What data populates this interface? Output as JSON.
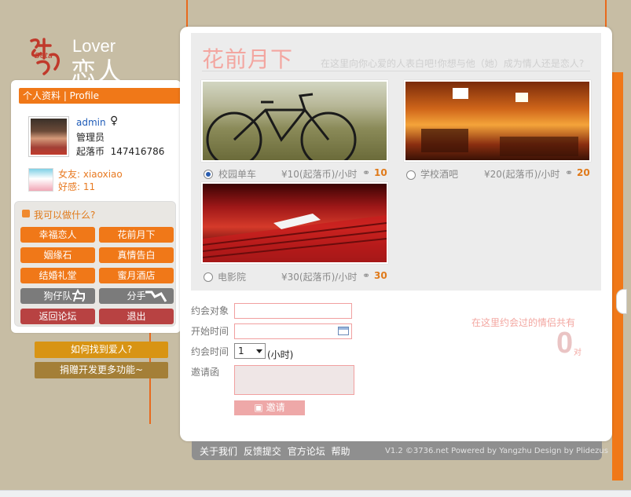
{
  "logo": {
    "beta": "Beta",
    "lover": "Lover",
    "name_cn": "恋人"
  },
  "profile": {
    "bar_label": "个人资料 | Profile",
    "username": "admin",
    "gender_symbol": "♀",
    "role": "管理员",
    "coin_label": "起落币",
    "coin_value": "147416786",
    "friend_label": "女友: xiaoxiao",
    "affinity_label": "好感: 11"
  },
  "actions": {
    "title": "我可以做什么?",
    "buttons": [
      {
        "label": "幸福恋人",
        "color": "#f07818"
      },
      {
        "label": "花前月下",
        "color": "#f07818"
      },
      {
        "label": "姻缘石",
        "color": "#f07818"
      },
      {
        "label": "真情告白",
        "color": "#f07818"
      },
      {
        "label": "结婚礼堂",
        "color": "#f07818"
      },
      {
        "label": "蜜月酒店",
        "color": "#f07818"
      },
      {
        "label": "狗仔队",
        "color": "#7b7b7b"
      },
      {
        "label": "分手",
        "color": "#7b7b7b"
      },
      {
        "label": "返回论坛",
        "color": "#b84242"
      },
      {
        "label": "退出",
        "color": "#b84242"
      }
    ]
  },
  "help_button": "如何找到爱人?",
  "donate_button": "捐赠开发更多功能~",
  "main": {
    "title": "花前月下",
    "subtitle": "在这里向你心爱的人表白吧!你想与他（她）成为情人还是恋人?",
    "venues": [
      {
        "name": "校园单车",
        "cost": "10(起落币)/小时",
        "count": "10",
        "selected": true
      },
      {
        "name": "学校酒吧",
        "cost": "20(起落币)/小时",
        "count": "20",
        "selected": false
      },
      {
        "name": "电影院",
        "cost": "30(起落币)/小时",
        "count": "30",
        "selected": false
      }
    ],
    "form": {
      "target_label": "约会对象",
      "start_label": "开始时间",
      "duration_label": "约会时间",
      "duration_value": "1",
      "duration_unit": "(小时)",
      "letter_label": "邀请函",
      "invite_button": "邀请"
    },
    "couples_text": "在这里约会过的情侣共有",
    "couples_count": "0",
    "couples_unit": "对"
  },
  "footer": {
    "links": [
      "关于我们",
      "反馈提交",
      "官方论坛",
      "帮助"
    ],
    "copyright": "V1.2 ©3736.net Powered by Yangzhu Design by Plidezus"
  },
  "colors": {
    "accent": "#f07818",
    "pink": "#f3a6a0",
    "gray_button": "#7b7b7b",
    "red_button": "#b84242"
  }
}
